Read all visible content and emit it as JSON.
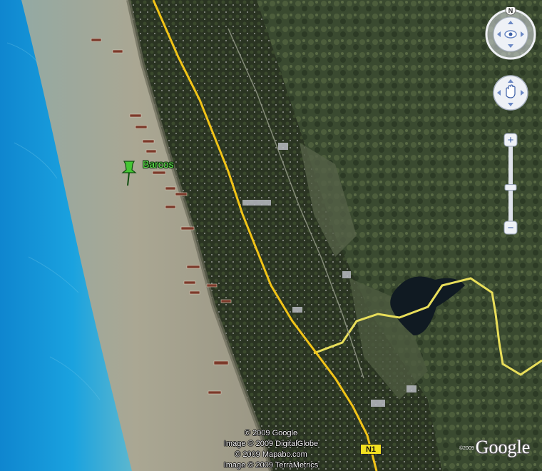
{
  "placemark": {
    "label": "Barcos",
    "color": "#5ee04a"
  },
  "road": {
    "shield": "N1",
    "color": "#f2c417"
  },
  "border_color": "#e8de5a",
  "sea_color": "#1a9ad6",
  "navigation": {
    "compass_label": "N",
    "zoom_in": "+",
    "zoom_out": "−",
    "zoom_level": 0.45,
    "icons": [
      "eye-icon",
      "hand-icon",
      "arrow-up-icon",
      "arrow-down-icon",
      "arrow-left-icon",
      "arrow-right-icon"
    ]
  },
  "credits": [
    "© 2009 Google",
    "Image © 2009 DigitalGlobe",
    "© 2009 Mapabc.com",
    "Image © 2009 TerraMetrics"
  ],
  "logo": {
    "text": "Google",
    "small": "©2009"
  }
}
